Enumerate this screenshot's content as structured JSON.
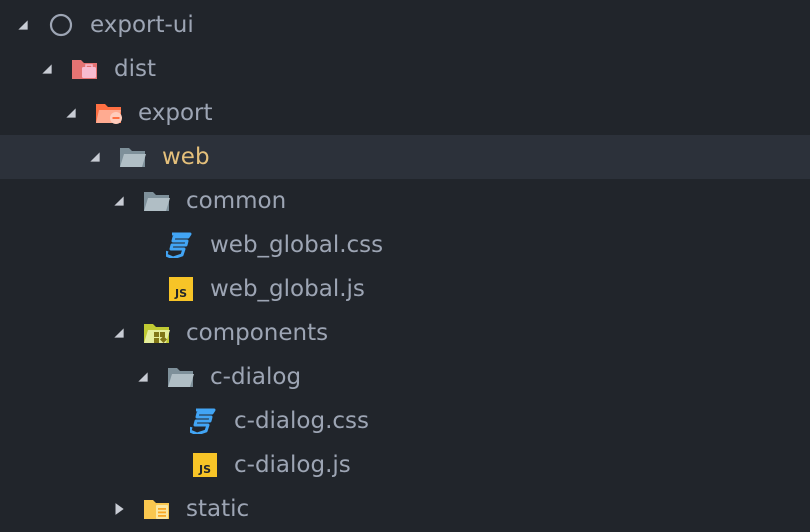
{
  "explorer": {
    "items": [
      {
        "label": "export-ui",
        "depth": 0,
        "expanded": true,
        "icon": "repo-circle-icon"
      },
      {
        "label": "dist",
        "depth": 1,
        "expanded": true,
        "icon": "folder-dist-icon"
      },
      {
        "label": "export",
        "depth": 2,
        "expanded": true,
        "icon": "folder-export-icon"
      },
      {
        "label": "web",
        "depth": 3,
        "expanded": true,
        "selected": true,
        "icon": "folder-open-icon"
      },
      {
        "label": "common",
        "depth": 4,
        "expanded": true,
        "icon": "folder-open-icon"
      },
      {
        "label": "web_global.css",
        "depth": 5,
        "icon": "css-file-icon"
      },
      {
        "label": "web_global.js",
        "depth": 5,
        "icon": "js-file-icon"
      },
      {
        "label": "components",
        "depth": 4,
        "expanded": true,
        "icon": "folder-components-icon"
      },
      {
        "label": "c-dialog",
        "depth": 5,
        "expanded": true,
        "icon": "folder-open-icon"
      },
      {
        "label": "c-dialog.css",
        "depth": 6,
        "icon": "css-file-icon"
      },
      {
        "label": "c-dialog.js",
        "depth": 6,
        "icon": "js-file-icon"
      },
      {
        "label": "static",
        "depth": 4,
        "expanded": false,
        "icon": "folder-static-icon"
      }
    ]
  },
  "colors": {
    "background": "#21252b",
    "selected_row": "#2c313a",
    "text": "#9da5b4",
    "selected_text": "#e5c07b",
    "css_icon": "#42a5f5",
    "js_icon": "#f7c427"
  }
}
